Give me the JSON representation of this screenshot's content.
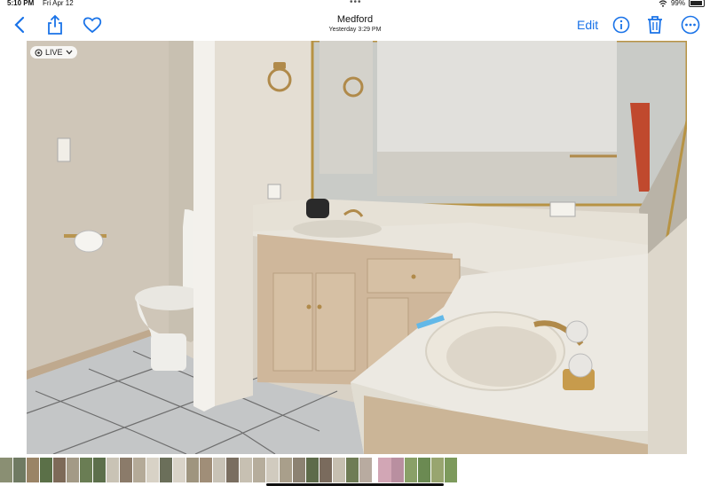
{
  "status_bar": {
    "time": "5:10 PM",
    "date": "Fri Apr 12",
    "battery": "99%"
  },
  "nav": {
    "title": "Medford",
    "subtitle": "Yesterday  3:29 PM",
    "edit_label": "Edit"
  },
  "photo": {
    "live_label": "LIVE"
  },
  "icons": [
    "back-chevron-icon",
    "share-icon",
    "heart-icon",
    "info-icon",
    "trash-icon",
    "more-icon",
    "wifi-icon",
    "battery-icon",
    "live-icon"
  ],
  "colors": {
    "accent": "#1a73e8"
  },
  "thumbnails": [
    "#8a8f73",
    "#6f7a62",
    "#9a8466",
    "#5b7048",
    "#7d6a58",
    "#a39a86",
    "#6a7d54",
    "#5c6f4b",
    "#c9c3b5",
    "#8b7b6a",
    "#b4aa98",
    "#d8d2c6",
    "#6b6f5a",
    "#d9d3c8",
    "#9f957f",
    "#a08e78",
    "#c8c2b6",
    "#7a6e60",
    "#c7c0b2",
    "#b6ad9c",
    "#d1cbbf",
    "#a99f8b",
    "#8c8272",
    "#5e6b4a",
    "#7a6b5d",
    "#c6bfb0",
    "#6f7c55",
    "#b8aba0",
    "#d2a6b5",
    "#b98fa0",
    "#8aa068",
    "#6b8a52",
    "#98a56f",
    "#7d9a5c"
  ]
}
